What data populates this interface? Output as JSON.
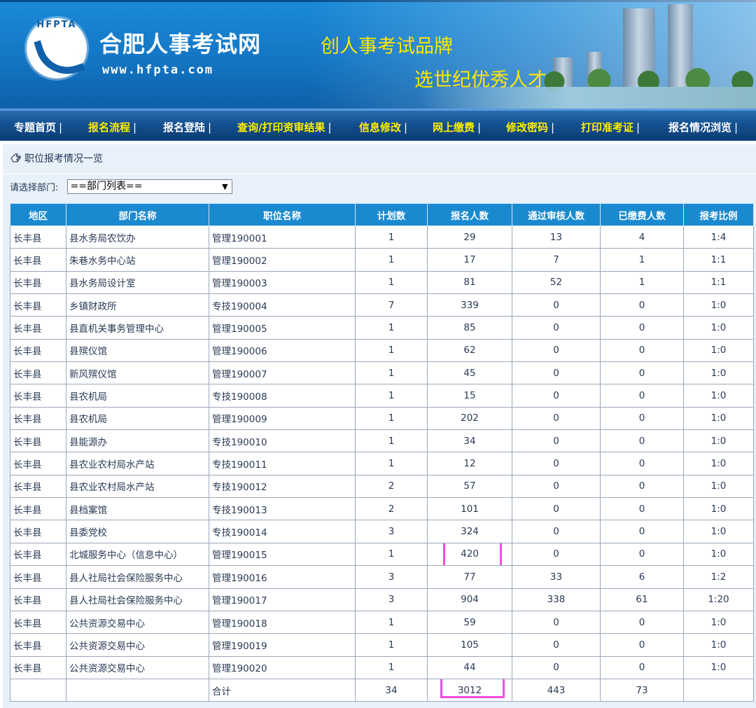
{
  "header": {
    "logo_text": "HFPTA",
    "site_title": "合肥人事考试网",
    "site_url": "www.hfpta.com",
    "slogan_1": "创人事考试品牌",
    "slogan_2": "选世纪优秀人才"
  },
  "nav": {
    "items": [
      {
        "label": "专题首页",
        "sep": "|"
      },
      {
        "label": "报名流程",
        "sep": "|"
      },
      {
        "label": "报名登陆",
        "sep": "|"
      },
      {
        "label": "查询/打印资审结果",
        "sep": "|"
      },
      {
        "label": "信息修改",
        "sep": "|"
      },
      {
        "label": "网上缴费",
        "sep": "|"
      },
      {
        "label": "修改密码",
        "sep": "|"
      },
      {
        "label": "打印准考证",
        "sep": "|"
      },
      {
        "label": "报名情况浏览",
        "sep": "|"
      }
    ]
  },
  "section": {
    "title": "职位报考情况一览",
    "filter_label": "请选择部门:",
    "filter_value": "==部门列表==",
    "filter_arrow": "▼"
  },
  "table": {
    "headers": [
      "地区",
      "部门名称",
      "职位名称",
      "计划数",
      "报名人数",
      "通过审核人数",
      "已缴费人数",
      "报考比例"
    ],
    "rows": [
      [
        "长丰县",
        "县水务局农饮办",
        "管理190001",
        "1",
        "29",
        "13",
        "4",
        "1:4"
      ],
      [
        "长丰县",
        "朱巷水务中心站",
        "管理190002",
        "1",
        "17",
        "7",
        "1",
        "1:1"
      ],
      [
        "长丰县",
        "县水务局设计室",
        "管理190003",
        "1",
        "81",
        "52",
        "1",
        "1:1"
      ],
      [
        "长丰县",
        "乡镇财政所",
        "专技190004",
        "7",
        "339",
        "0",
        "0",
        "1:0"
      ],
      [
        "长丰县",
        "县直机关事务管理中心",
        "管理190005",
        "1",
        "85",
        "0",
        "0",
        "1:0"
      ],
      [
        "长丰县",
        "县殡仪馆",
        "管理190006",
        "1",
        "62",
        "0",
        "0",
        "1:0"
      ],
      [
        "长丰县",
        "新风殡仪馆",
        "管理190007",
        "1",
        "45",
        "0",
        "0",
        "1:0"
      ],
      [
        "长丰县",
        "县农机局",
        "专技190008",
        "1",
        "15",
        "0",
        "0",
        "1:0"
      ],
      [
        "长丰县",
        "县农机局",
        "管理190009",
        "1",
        "202",
        "0",
        "0",
        "1:0"
      ],
      [
        "长丰县",
        "县能源办",
        "专技190010",
        "1",
        "34",
        "0",
        "0",
        "1:0"
      ],
      [
        "长丰县",
        "县农业农村局水产站",
        "专技190011",
        "1",
        "12",
        "0",
        "0",
        "1:0"
      ],
      [
        "长丰县",
        "县农业农村局水产站",
        "专技190012",
        "2",
        "57",
        "0",
        "0",
        "1:0"
      ],
      [
        "长丰县",
        "县档案馆",
        "专技190013",
        "2",
        "101",
        "0",
        "0",
        "1:0"
      ],
      [
        "长丰县",
        "县委党校",
        "专技190014",
        "3",
        "324",
        "0",
        "0",
        "1:0"
      ],
      [
        "长丰县",
        "北城服务中心（信息中心）",
        "管理190015",
        "1",
        "420",
        "0",
        "0",
        "1:0"
      ],
      [
        "长丰县",
        "县人社局社会保险服务中心",
        "管理190016",
        "3",
        "77",
        "33",
        "6",
        "1:2"
      ],
      [
        "长丰县",
        "县人社局社会保险服务中心",
        "管理190017",
        "3",
        "904",
        "338",
        "61",
        "1:20"
      ],
      [
        "长丰县",
        "公共资源交易中心",
        "管理190018",
        "1",
        "59",
        "0",
        "0",
        "1:0"
      ],
      [
        "长丰县",
        "公共资源交易中心",
        "管理190019",
        "1",
        "105",
        "0",
        "0",
        "1:0"
      ],
      [
        "长丰县",
        "公共资源交易中心",
        "管理190020",
        "1",
        "44",
        "0",
        "0",
        "1:0"
      ]
    ],
    "total": [
      "",
      "",
      "合计",
      "34",
      "3012",
      "443",
      "73",
      ""
    ]
  },
  "colors": {
    "header_bg": "#1a8ad0",
    "nav_yellow": "#ffee00",
    "highlight": "#f24ddc"
  }
}
